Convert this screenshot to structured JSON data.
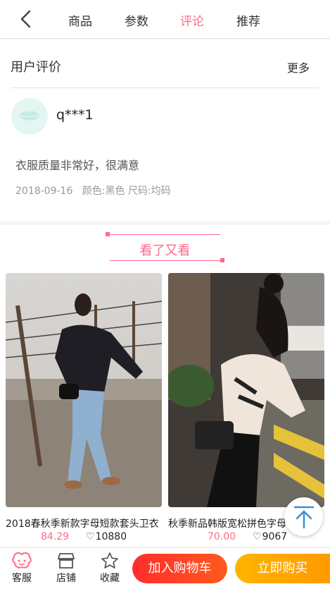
{
  "nav": {
    "tabs": [
      {
        "label": "商品",
        "active": false
      },
      {
        "label": "参数",
        "active": false
      },
      {
        "label": "评论",
        "active": true
      },
      {
        "label": "推荐",
        "active": false
      }
    ]
  },
  "review": {
    "title": "用户评价",
    "more": "更多",
    "username": "q***1",
    "text": "衣服质量非常好，很满意",
    "date": "2018-09-16",
    "spec": "颜色:黑色 尺码:均码"
  },
  "section": {
    "title": "看了又看"
  },
  "products": [
    {
      "name": "2018春秋季新款字母短款套头卫衣",
      "price": "84.29",
      "likes": "10880"
    },
    {
      "name": "秋季新品韩版宽松拼色字母毛衣",
      "price": "70.00",
      "likes": "9067"
    }
  ],
  "bottom": {
    "service": "客服",
    "shop": "店铺",
    "favorite": "收藏",
    "add_cart": "加入购物车",
    "buy_now": "立即购买"
  },
  "colors": {
    "accent": "#ff6a88",
    "cart": "#ff3b2b",
    "buy": "#ffab00"
  }
}
